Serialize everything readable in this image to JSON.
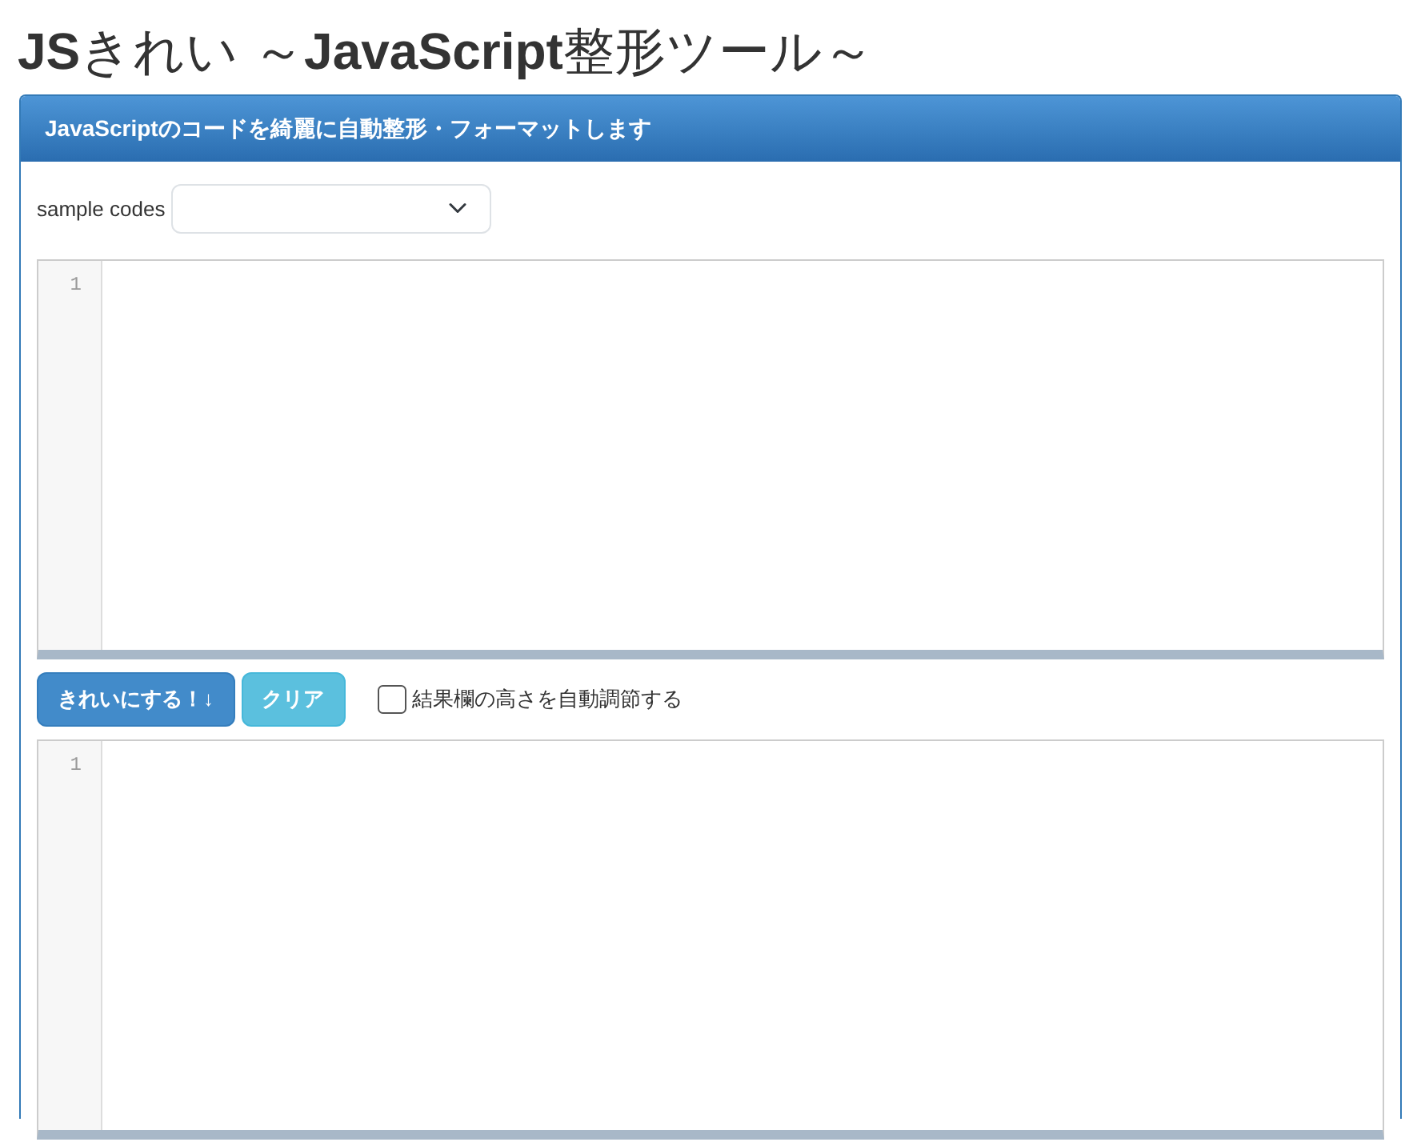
{
  "title": "**JS**きれい ～**JavaScript**整形ツール～",
  "panel": {
    "heading": "JavaScriptのコードを綺麗に自動整形・フォーマットします",
    "sample_label": "sample codes",
    "input_editor": {
      "line_numbers": [
        "1"
      ]
    },
    "buttons": [
      {
        "label": "きれいにする！↓",
        "kind": "primary"
      },
      {
        "label": "クリア",
        "kind": "info"
      }
    ],
    "auto_height": {
      "label": "結果欄の高さを自動調節する",
      "checked": false
    },
    "output_editor": {
      "line_numbers": [
        "1"
      ]
    }
  }
}
